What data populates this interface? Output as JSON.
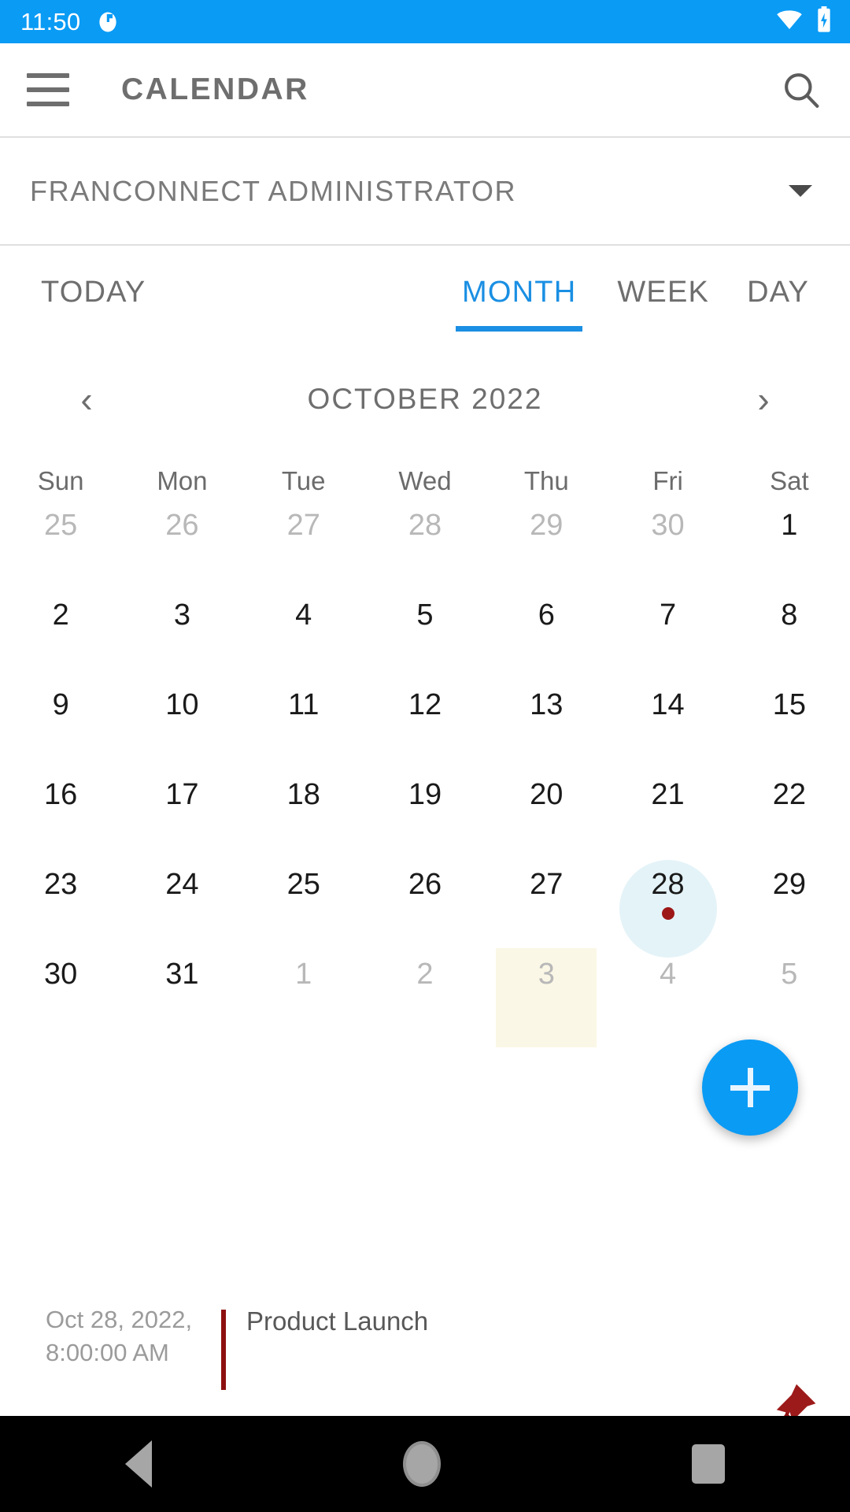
{
  "status_bar": {
    "time": "11:50",
    "app_icon": "app-badge-icon",
    "wifi_icon": "wifi-icon",
    "battery_icon": "battery-charging-icon",
    "background": "#0a9bf5"
  },
  "toolbar": {
    "menu_icon": "hamburger-menu-icon",
    "title": "CALENDAR",
    "search_icon": "search-icon"
  },
  "account": {
    "name": "FRANCONNECT ADMINISTRATOR",
    "dropdown_icon": "chevron-down-icon"
  },
  "tabs": {
    "today": "TODAY",
    "month": "MONTH",
    "week": "WEEK",
    "day": "DAY",
    "active": "MONTH",
    "accent": "#1a8fe3"
  },
  "month_nav": {
    "prev_icon": "chevron-left-icon",
    "title": "OCTOBER 2022",
    "next_icon": "chevron-right-icon"
  },
  "calendar": {
    "weekdays": [
      "Sun",
      "Mon",
      "Tue",
      "Wed",
      "Thu",
      "Fri",
      "Sat"
    ],
    "weeks": [
      [
        {
          "day": "25",
          "in_month": false
        },
        {
          "day": "26",
          "in_month": false
        },
        {
          "day": "27",
          "in_month": false
        },
        {
          "day": "28",
          "in_month": false
        },
        {
          "day": "29",
          "in_month": false
        },
        {
          "day": "30",
          "in_month": false
        },
        {
          "day": "1",
          "in_month": true
        }
      ],
      [
        {
          "day": "2",
          "in_month": true
        },
        {
          "day": "3",
          "in_month": true
        },
        {
          "day": "4",
          "in_month": true
        },
        {
          "day": "5",
          "in_month": true
        },
        {
          "day": "6",
          "in_month": true
        },
        {
          "day": "7",
          "in_month": true
        },
        {
          "day": "8",
          "in_month": true
        }
      ],
      [
        {
          "day": "9",
          "in_month": true
        },
        {
          "day": "10",
          "in_month": true
        },
        {
          "day": "11",
          "in_month": true
        },
        {
          "day": "12",
          "in_month": true
        },
        {
          "day": "13",
          "in_month": true
        },
        {
          "day": "14",
          "in_month": true
        },
        {
          "day": "15",
          "in_month": true
        }
      ],
      [
        {
          "day": "16",
          "in_month": true
        },
        {
          "day": "17",
          "in_month": true
        },
        {
          "day": "18",
          "in_month": true
        },
        {
          "day": "19",
          "in_month": true
        },
        {
          "day": "20",
          "in_month": true
        },
        {
          "day": "21",
          "in_month": true
        },
        {
          "day": "22",
          "in_month": true
        }
      ],
      [
        {
          "day": "23",
          "in_month": true
        },
        {
          "day": "24",
          "in_month": true
        },
        {
          "day": "25",
          "in_month": true
        },
        {
          "day": "26",
          "in_month": true
        },
        {
          "day": "27",
          "in_month": true
        },
        {
          "day": "28",
          "in_month": true,
          "selected": true,
          "has_event": true
        },
        {
          "day": "29",
          "in_month": true
        }
      ],
      [
        {
          "day": "30",
          "in_month": true
        },
        {
          "day": "31",
          "in_month": true
        },
        {
          "day": "1",
          "in_month": false
        },
        {
          "day": "2",
          "in_month": false
        },
        {
          "day": "3",
          "in_month": false,
          "tinted": true
        },
        {
          "day": "4",
          "in_month": false
        },
        {
          "day": "5",
          "in_month": false
        }
      ]
    ],
    "selected_circle_color": "#e4f3f8",
    "tinted_color": "#fbf7e6",
    "event_dot_color": "#9d1717"
  },
  "fab": {
    "icon": "plus-icon",
    "color": "#0a9bf5"
  },
  "events": [
    {
      "when": "Oct 28, 2022, 8:00:00 AM",
      "title": "Product Launch",
      "bar_color": "#8d1010"
    }
  ],
  "pin": {
    "icon": "pin-icon",
    "color": "#9d1a1a"
  },
  "nav_bar": {
    "back_icon": "back-triangle-icon",
    "home_icon": "home-circle-icon",
    "recents_icon": "recents-square-icon"
  }
}
